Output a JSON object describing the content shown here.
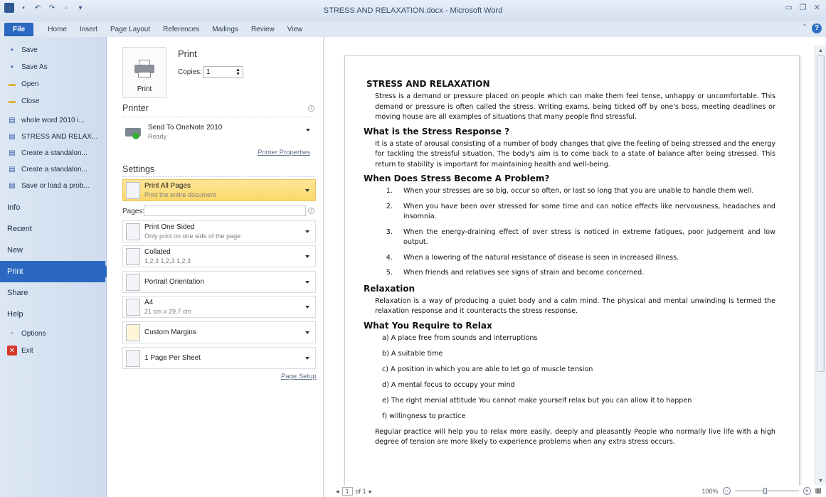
{
  "window": {
    "title": "STRESS AND RELAXATION.docx  -  Microsoft Word",
    "app_icon_letter": "W"
  },
  "ribbon_tabs": [
    "File",
    "Home",
    "Insert",
    "Page Layout",
    "References",
    "Mailings",
    "Review",
    "View"
  ],
  "nav": {
    "commands": [
      "Save",
      "Save As",
      "Open",
      "Close"
    ],
    "recent_docs": [
      "whole word 2010 i...",
      "STRESS AND RELAX...",
      "Create a standalon...",
      "Create a standalon...",
      "Save or load a prob..."
    ],
    "sections": [
      "Info",
      "Recent",
      "New",
      "Print",
      "Share",
      "Help"
    ],
    "bottom": [
      "Options",
      "Exit"
    ],
    "active": "Print"
  },
  "print": {
    "heading": "Print",
    "button_label": "Print",
    "copies_label": "Copies:",
    "copies_value": "1",
    "printer_heading": "Printer",
    "printer_name": "Send To OneNote 2010",
    "printer_status": "Ready",
    "printer_properties": "Printer Properties",
    "settings_heading": "Settings",
    "pages_label": "Pages:",
    "page_setup": "Page Setup",
    "options": [
      {
        "l1": "Print All Pages",
        "l2": "Print the entire document"
      },
      {
        "l1": "Print One Sided",
        "l2": "Only print on one side of the page"
      },
      {
        "l1": "Collated",
        "l2": "1,2,3   1,2,3   1,2,3"
      },
      {
        "l1": "Portrait Orientation",
        "l2": ""
      },
      {
        "l1": "A4",
        "l2": "21 cm x 29.7 cm"
      },
      {
        "l1": "Custom Margins",
        "l2": ""
      },
      {
        "l1": "1 Page Per Sheet",
        "l2": ""
      }
    ]
  },
  "document": {
    "title": "STRESS AND RELAXATION",
    "intro": "Stress is a demand or pressure placed on people which can make them feel tense, unhappy or uncomfortable. This demand or pressure is often called the stress. Writing exams, being ticked off by one's boss, meeting deadlines or moving house are all examples of situations that many people find stressful.",
    "h_response": "What is the Stress Response ?",
    "p_response": "It is a state of arousal consisting of a number of body changes that give the feeling of being stressed and the energy for tackling the stressful situation. The body's aim is to come back to a state of balance after being stressed.    This return to stability is important for maintaining health and well-being.",
    "h_problem": "When Does Stress Become A Problem?",
    "problem_items": [
      "When your stresses are so big, occur so often, or last so long that you are unable to handle them well.",
      "When you have been over stressed for some time and can notice effects like nervousness, headaches and insomnia.",
      "When the energy-draining effect of over stress is noticed in extreme fatigues, poor judgement and low output.",
      "When a lowering of the natural resistance of disease is seen in increased illness.",
      "When friends and relatives see signs of strain and become concerned."
    ],
    "h_relax": "Relaxation",
    "p_relax": "Relaxation is a way of producing a quiet body and a calm mind. The physical and mental unwinding is termed the relaxation response and it counteracts the stress response.",
    "h_require": "What You Require to Relax",
    "require_items": [
      "a)  A place free from sounds and interruptions",
      "b)  A suitable time",
      "c)  A position in which you are able to let go of muscle tension",
      "d)  A mental focus to occupy your mind",
      "e)  The right menial attitude You cannot make yourself relax but you can allow it to happen",
      "f)   willingness to practice"
    ],
    "p_final": "Regular practice will help you to relax more easily, deeply and pleasantly People who normally live life with a high degree of tension are more likely to experience problems when any extra stress occurs."
  },
  "status": {
    "page_box": "1",
    "of_pages": "of 1",
    "zoom": "100%"
  },
  "colors": {
    "accent": "#2a68c1",
    "highlight": "#fcd86a"
  }
}
